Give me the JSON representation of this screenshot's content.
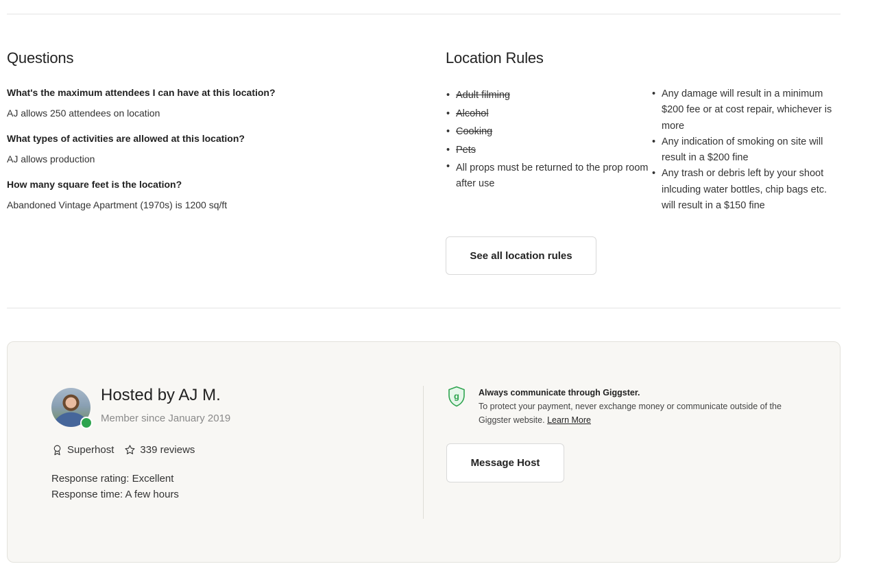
{
  "questions": {
    "title": "Questions",
    "items": [
      {
        "question": "What's the maximum attendees I can have at this location?",
        "answer": "AJ allows 250 attendees on location"
      },
      {
        "question": "What types of activities are allowed at this location?",
        "answer": "AJ allows production"
      },
      {
        "question": "How many square feet is the location?",
        "answer": "Abandoned Vintage Apartment (1970s) is 1200 sq/ft"
      }
    ]
  },
  "rules": {
    "title": "Location Rules",
    "left": [
      {
        "text": "Adult filming",
        "disallowed": true
      },
      {
        "text": "Alcohol",
        "disallowed": true
      },
      {
        "text": "Cooking",
        "disallowed": true
      },
      {
        "text": "Pets",
        "disallowed": true
      },
      {
        "text": "All props must be returned to the prop room after use",
        "disallowed": false
      }
    ],
    "right": [
      {
        "text": "Any damage will result in a minimum $200 fee or at cost repair, whichever is more"
      },
      {
        "text": "Any indication of smoking on site will result in a $200 fine"
      },
      {
        "text": "Any trash or debris left by your shoot inlcuding water bottles, chip bags etc. will result in a $150 fine"
      }
    ],
    "see_all_label": "See all location rules"
  },
  "host": {
    "name": "Hosted by AJ M.",
    "member_since": "Member since January 2019",
    "superhost_label": "Superhost",
    "reviews_label": "339 reviews",
    "response_rating": "Response rating: Excellent",
    "response_time": "Response time: A few hours",
    "avatar_icon": "host-avatar",
    "badge_color": "#2ea44f"
  },
  "notice": {
    "title": "Always communicate through Giggster.",
    "text": "To protect your payment, never exchange money or communicate outside of the Giggster website.",
    "link_label": "Learn More",
    "icon": "giggster-shield-icon",
    "accent": "#2ea44f"
  },
  "message_host_label": "Message Host"
}
